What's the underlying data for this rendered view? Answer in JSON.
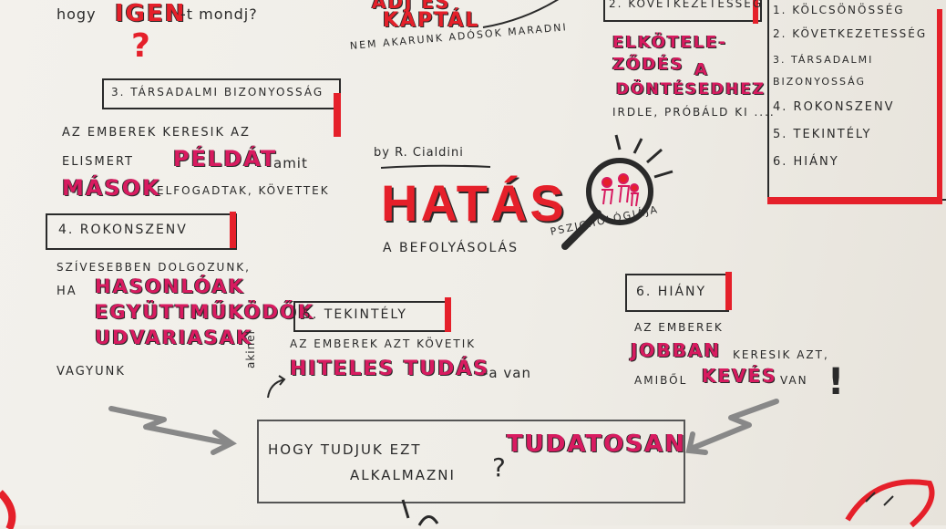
{
  "top": {
    "hogy": "hogy",
    "igen": "IGEN",
    "igen_rest": "-t mondj?",
    "question_mark": "?",
    "ads": "ADJ ÉS",
    "kaptal": "KAPTÁL",
    "nem_akarunk": "NEM AKARUNK ADÓSOK MARADNI"
  },
  "section3": {
    "title": "3. TÁRSADALMI BIZONYOSSÁG",
    "line1": "AZ EMBEREK KERESIK AZ",
    "line2_pre": "ELISMERT",
    "line2_mag": "PÉLDÁT",
    "line2_post": "amit",
    "line3_mag": "MÁSOK",
    "line3_post": "ELFOGADTAK, KÖVETTEK"
  },
  "section4": {
    "title": "4. ROKONSZENV",
    "line1": "SZÍVESEBBEN DOLGOZUNK,",
    "line2_pre": "HA",
    "line2_mag": "HASONLÓAK",
    "line3_mag": "EGYÜTTMŰKÖDŐK",
    "line4_mag": "UDVARIASAK",
    "line5": "VAGYUNK"
  },
  "section5": {
    "title": "5. TEKINTÉLY",
    "line1": "AZ EMBEREK AZT KÖVETIK",
    "akinel": "akinél",
    "line2_mag": "HITELES TUDÁS",
    "line2_post": "-a van"
  },
  "section6": {
    "title": "6. HIÁNY",
    "line1": "AZ EMBEREK",
    "line2_mag": "JOBBAN",
    "line2_post": "KERESIK AZT,",
    "line3_pre": "AMIBŐL",
    "line3_mag": "KEVÉS",
    "line3_post": "VAN",
    "excl": "!"
  },
  "center": {
    "author": "by R. Cialdini",
    "title": "HATÁS",
    "sub1": "A BEFOLYÁSOLÁS",
    "sub2": "PSZICHOLÓGIÁJA"
  },
  "commitment": {
    "line1": "ELKÖTELE-",
    "line2": "ZŐDÉS",
    "line2b": "A",
    "line3": "DÖNTÉSEDHEZ",
    "line4": "IRDLE, PRÓBÁLD KI ....",
    "box_label": "2. KÖVETKEZETESSÉG"
  },
  "list": {
    "items": [
      "1. KÖLCSÖNÖSSÉG",
      "2. KÖVETKEZETESSÉG",
      "3. TÁRSADALMI BIZONYOSSÁG",
      "4. ROKONSZENV",
      "5. TEKINTÉLY",
      "6. HIÁNY"
    ]
  },
  "bottom": {
    "line1_pre": "HOGY TUDJUK EZT",
    "line1_mag": "TUDATOSAN",
    "line2": "ALKALMAZNI",
    "qmark": "?"
  },
  "colors": {
    "accent_magenta": "#d81b60",
    "accent_red": "#e5202a",
    "ink": "#2a2a2a",
    "paper": "#efede7"
  }
}
